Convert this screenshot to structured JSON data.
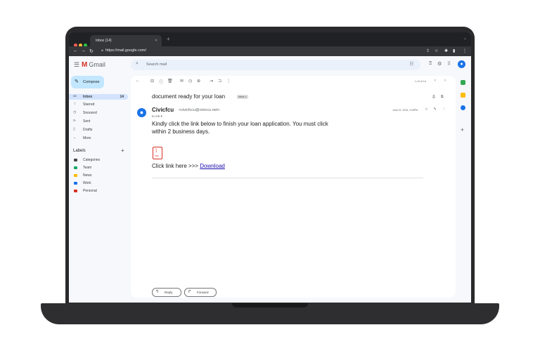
{
  "browser": {
    "tab_title": "Inbox (14)",
    "url": "https://mail.google.com/",
    "new_tab_symbol": "+"
  },
  "gmail": {
    "logo_text": "Gmail",
    "search_placeholder": "Search mail",
    "compose_label": "Compose",
    "nav": [
      {
        "label": "Inbox",
        "count": "14",
        "icon": "inbox-icon"
      },
      {
        "label": "Starred",
        "count": "",
        "icon": "star-icon"
      },
      {
        "label": "Snoozed",
        "count": "",
        "icon": "clock-icon"
      },
      {
        "label": "Sent",
        "count": "",
        "icon": "send-icon"
      },
      {
        "label": "Drafts",
        "count": "",
        "icon": "draft-icon"
      },
      {
        "label": "More",
        "count": "",
        "icon": "chevron-down-icon"
      }
    ],
    "labels_heading": "Labels",
    "labels": [
      {
        "name": "Categories",
        "color": "#444746"
      },
      {
        "name": "Team",
        "color": "#16a765"
      },
      {
        "name": "News",
        "color": "#fbbc04"
      },
      {
        "name": "Work",
        "color": "#1a73e8"
      },
      {
        "name": "Personal",
        "color": "#d93025"
      }
    ],
    "pager": "1-14 of 14"
  },
  "email": {
    "subject": "document ready for your loan",
    "chip": "Inbox ×",
    "sender_name": "Civicfcu",
    "sender_email": "<civicfccu@civiccu.net>",
    "to": "to me ▾",
    "date": "June 22, 2016, 2:26PM",
    "body": "Kindly click the link below to finish your loan application. You must click within 2 business days.",
    "pdf_text": "PDF",
    "click_prefix": "Click link here >>> ",
    "link_text": "Download",
    "reply_label": "Reply",
    "forward_label": "Forward"
  },
  "colors": {
    "accent": "#1a73e8",
    "compose_bg": "#c2e7ff",
    "active_nav": "#d3e3fd",
    "pdf_red": "#d93025"
  }
}
